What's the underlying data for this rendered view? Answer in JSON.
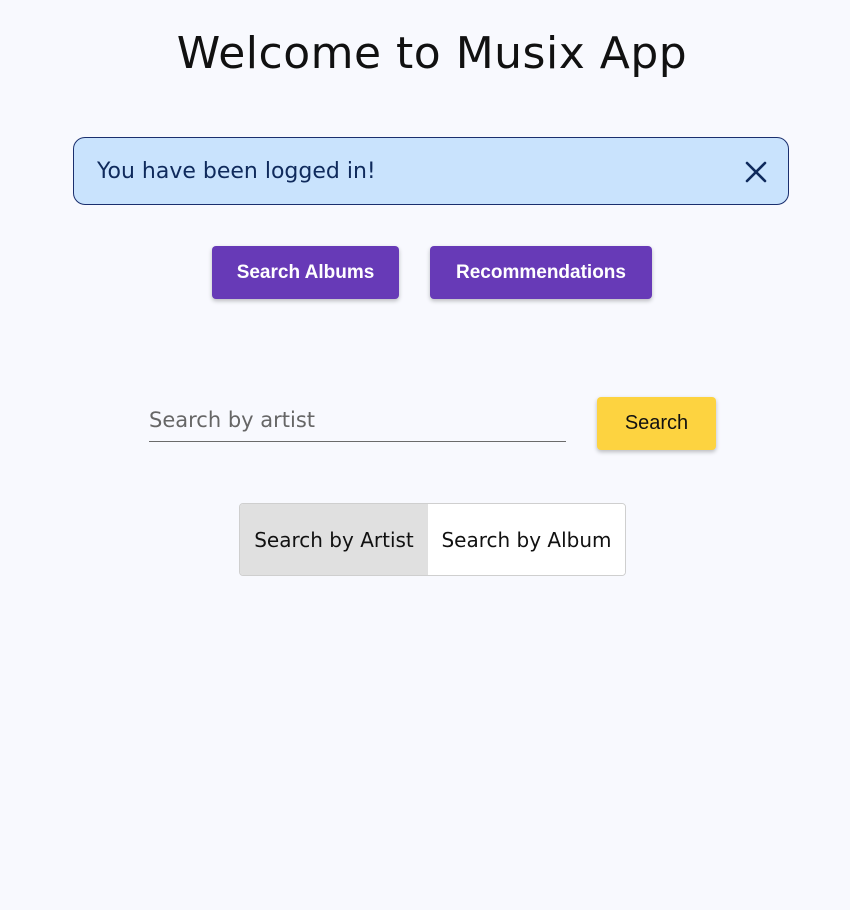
{
  "header": {
    "title": "Welcome to Musix App"
  },
  "alert": {
    "message": "You have been logged in!",
    "close_icon": "close-icon",
    "background_color": "#c9e3fd",
    "border_color": "#1a2f6e"
  },
  "nav": {
    "search_albums_label": "Search Albums",
    "recommendations_label": "Recommendations",
    "button_color": "#673ab7"
  },
  "search": {
    "placeholder": "Search by artist",
    "value": "",
    "button_label": "Search",
    "button_color": "#fdd340"
  },
  "toggle": {
    "options": [
      {
        "label": "Search by Artist",
        "selected": true
      },
      {
        "label": "Search by Album",
        "selected": false
      }
    ]
  }
}
